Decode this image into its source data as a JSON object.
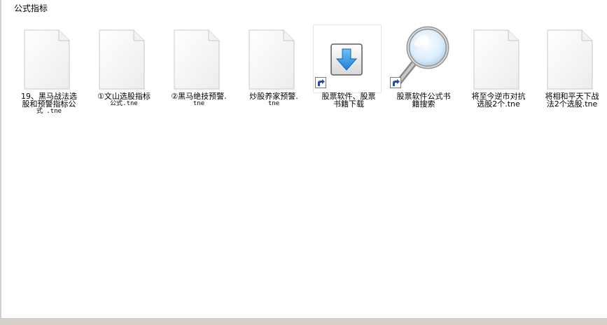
{
  "window": {
    "title": "公式指标"
  },
  "items": [
    {
      "name": "19、黑马战法选股和预警指标公式 .tne",
      "line1": "19、黑马战法选",
      "line2": "股和预警指标公",
      "line3": "式 .tne",
      "kind": "document",
      "icon": "blank-document-icon"
    },
    {
      "name": "①文山选股指标公式.tne",
      "line1": "①文山选股指标",
      "line2": "公式.tne",
      "line3": "",
      "kind": "document",
      "icon": "blank-document-icon"
    },
    {
      "name": "②黑马绝技预警.tne",
      "line1": "②黑马绝技预警.",
      "line2": "tne",
      "line3": "",
      "kind": "document",
      "icon": "blank-document-icon"
    },
    {
      "name": "炒股养家预警.tne",
      "line1": "炒股养家预警.",
      "line2": "tne",
      "line3": "",
      "kind": "document",
      "icon": "blank-document-icon"
    },
    {
      "name": "股票软件、股票书籍下载",
      "line1": "股票软件、股票",
      "line2": "书籍下载",
      "line3": "",
      "kind": "shortcut",
      "icon": "download-arrow-icon"
    },
    {
      "name": "股票软件公式书籍搜索",
      "line1": "股票软件公式书",
      "line2": "籍搜索",
      "line3": "",
      "kind": "shortcut",
      "icon": "magnifier-icon"
    },
    {
      "name": "将至今逆市对抗选股2个.tne",
      "line1": "将至今逆市对抗",
      "line2": "选股2个.tne",
      "line3": "",
      "kind": "document",
      "icon": "blank-document-icon"
    },
    {
      "name": "将相和平天下战法2个选股.tne",
      "line1": "将相和平天下战",
      "line2": "法2个选股.tne",
      "line3": "",
      "kind": "document",
      "icon": "blank-document-icon"
    }
  ],
  "colors": {
    "chrome": "#d4d0c8",
    "download_blue": "#1e7fd8",
    "shortcut_arrow_bg": "#ffffff"
  }
}
